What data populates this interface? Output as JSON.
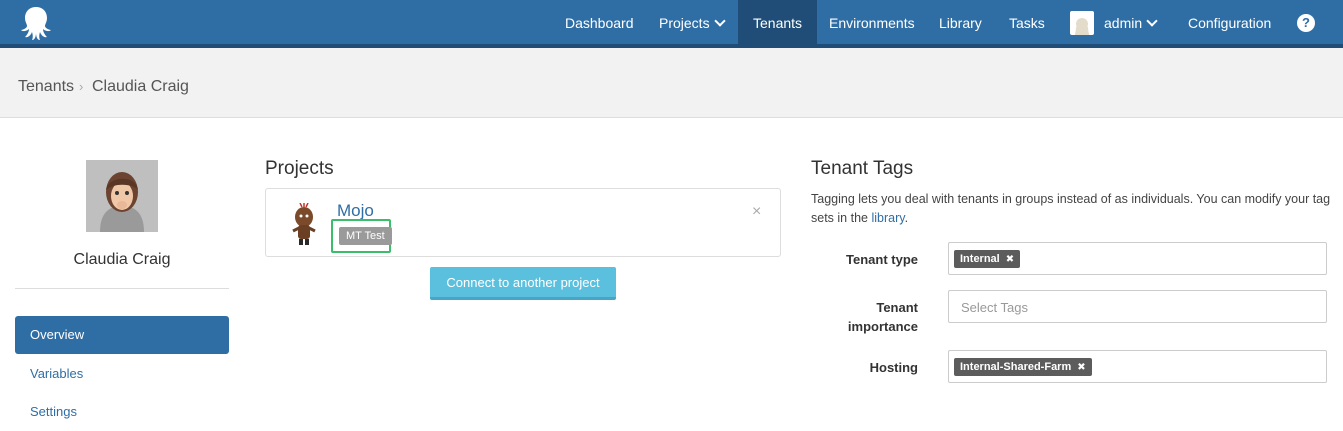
{
  "nav": {
    "items": [
      {
        "label": "Dashboard"
      },
      {
        "label": "Projects"
      },
      {
        "label": "Tenants"
      },
      {
        "label": "Environments"
      },
      {
        "label": "Library"
      },
      {
        "label": "Tasks"
      },
      {
        "label": "admin"
      },
      {
        "label": "Configuration"
      }
    ],
    "active": "Tenants",
    "help_symbol": "?"
  },
  "breadcrumb": {
    "parent": "Tenants",
    "separator": "›",
    "current": "Claudia Craig"
  },
  "tenant": {
    "name": "Claudia Craig"
  },
  "sidebar": {
    "items": [
      {
        "label": "Overview",
        "active": true
      },
      {
        "label": "Variables",
        "active": false
      },
      {
        "label": "Settings",
        "active": false
      }
    ]
  },
  "projects": {
    "title": "Projects",
    "list": [
      {
        "name": "Mojo",
        "tag": "MT Test",
        "remove_symbol": "×"
      }
    ],
    "connect_label": "Connect to another project"
  },
  "tenant_tags": {
    "title": "Tenant Tags",
    "description_pre": "Tagging lets you deal with tenants in groups instead of as individuals. You can modify your tag sets in the ",
    "description_link": "library",
    "description_post": ".",
    "fields": [
      {
        "label": "Tenant type",
        "chip": "Internal",
        "placeholder": ""
      },
      {
        "label": "Tenant importance",
        "chip": "",
        "placeholder": "Select Tags"
      },
      {
        "label": "Hosting",
        "chip": "Internal-Shared-Farm",
        "placeholder": ""
      }
    ],
    "chip_remove_symbol": "✖"
  },
  "colors": {
    "nav_bg": "#2f6ea5",
    "nav_active": "#1f4d77",
    "accent": "#2f6ea5",
    "button": "#5bc0de",
    "highlight": "#3cbd6b"
  }
}
